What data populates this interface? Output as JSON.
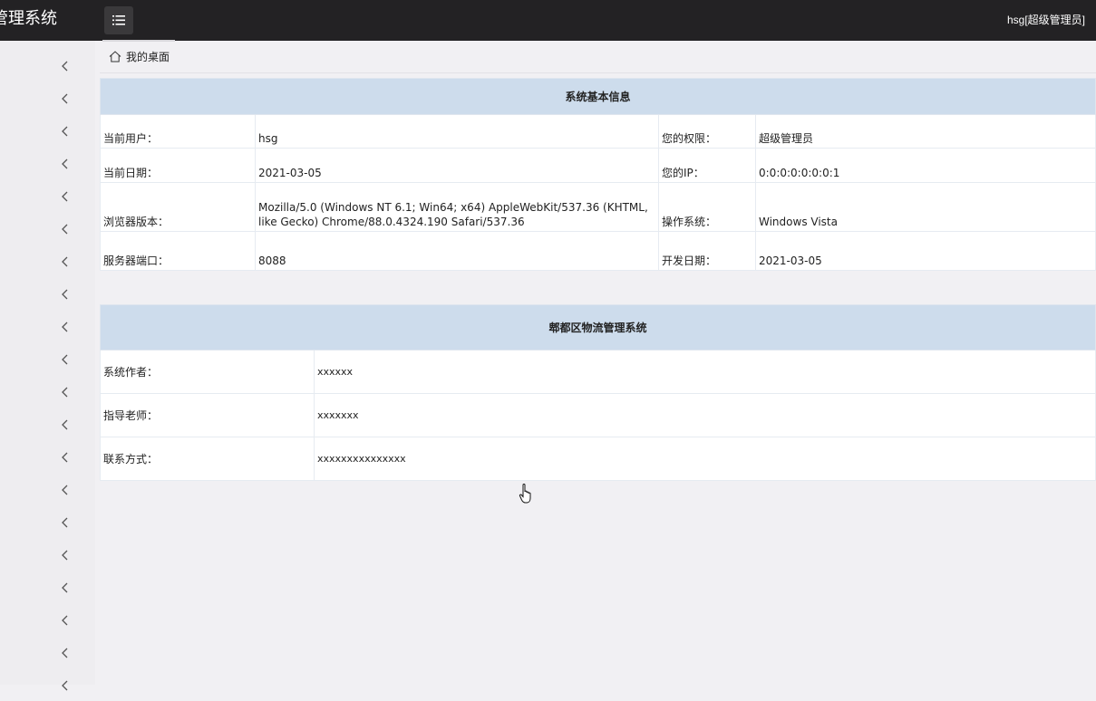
{
  "header": {
    "brand": "管理系统",
    "user": "hsg[超级管理员]"
  },
  "breadcrumb": {
    "home": "我的桌面"
  },
  "system_info": {
    "title": "系统基本信息",
    "rows": [
      {
        "label1": "当前用户：",
        "value1": "hsg",
        "label2": "您的权限：",
        "value2": "超级管理员"
      },
      {
        "label1": "当前日期：",
        "value1": "2021-03-05",
        "label2": "您的IP：",
        "value2": "0:0:0:0:0:0:0:1"
      },
      {
        "label1": "浏览器版本：",
        "value1": "Mozilla/5.0 (Windows NT 6.1; Win64; x64) AppleWebKit/537.36 (KHTML, like Gecko) Chrome/88.0.4324.190 Safari/537.36",
        "label2": "操作系统：",
        "value2": "Windows Vista"
      },
      {
        "label1": "服务器端口：",
        "value1": "8088",
        "label2": "开发日期：",
        "value2": "2021-03-05"
      }
    ]
  },
  "about": {
    "title": "郫都区物流管理系统",
    "rows": [
      {
        "label": "系统作者：",
        "value": "xxxxxx"
      },
      {
        "label": "指导老师：",
        "value": "xxxxxxx"
      },
      {
        "label": "联系方式：",
        "value": "xxxxxxxxxxxxxxx"
      }
    ]
  },
  "sidebar": {
    "item_count": 20,
    "icon": "chevron-left-icon"
  }
}
